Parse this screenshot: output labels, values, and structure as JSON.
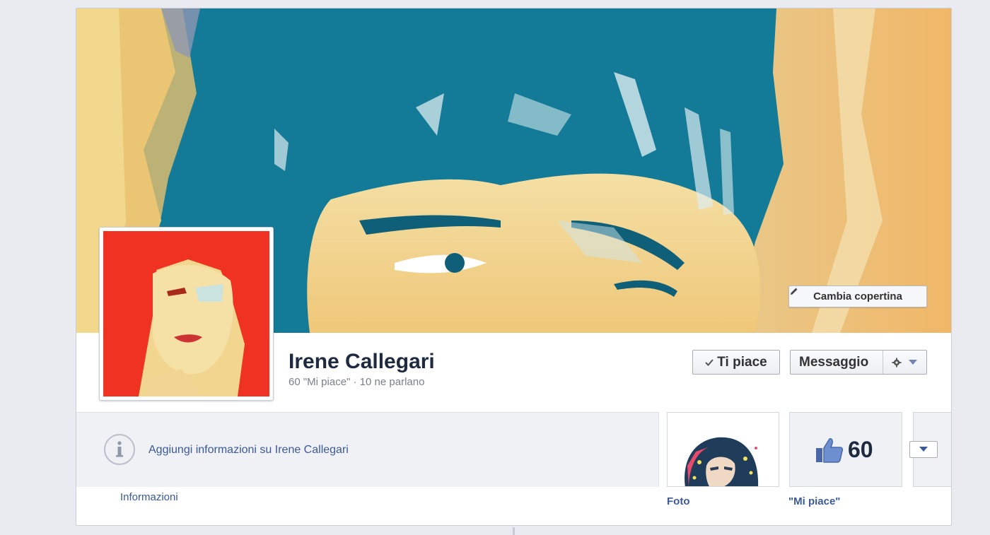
{
  "cover": {
    "change_cover_label": "Cambia copertina"
  },
  "profile": {
    "name": "Irene Callegari",
    "stats": "60 \"Mi piace\" · 10 ne parlano"
  },
  "actions": {
    "like_label": "Ti piace",
    "message_label": "Messaggio"
  },
  "info_panel": {
    "add_info_link": "Aggiungi informazioni su Irene Callegari",
    "label": "Informazioni"
  },
  "tiles": {
    "photo_label": "Foto",
    "likes_label": "\"Mi piace\"",
    "likes_count": "60"
  },
  "colors": {
    "link": "#3b5998",
    "cover_blue": "#137a97",
    "avatar_red": "#ef3222"
  },
  "icons": {
    "cover_button": "pencil-icon",
    "like_button": "check-icon",
    "settings": "gear-icon",
    "settings_menu": "chevron-down-icon",
    "info": "info-icon",
    "likes": "thumbs-up-icon",
    "more": "chevron-down-icon"
  }
}
